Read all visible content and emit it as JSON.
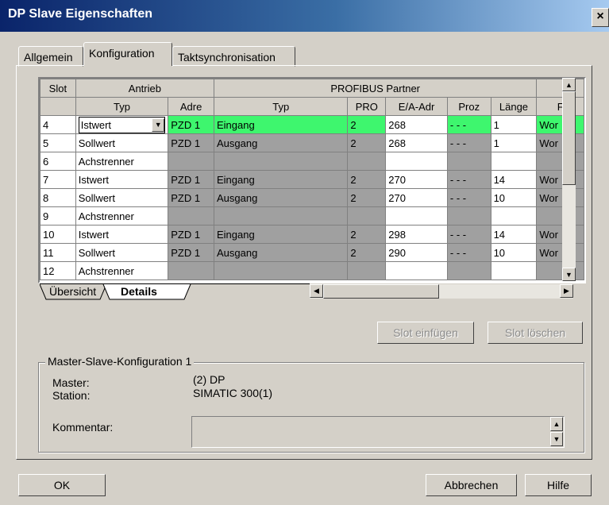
{
  "window": {
    "title": "DP Slave Eigenschaften",
    "close": "×"
  },
  "tabs": [
    "Allgemein",
    "Konfiguration",
    "Taktsynchronisation"
  ],
  "grid": {
    "group_headers": {
      "slot": "Slot",
      "antrieb": "Antrieb",
      "profibus": "PROFIBUS Partner"
    },
    "columns": [
      "Typ",
      "Adre",
      "Typ",
      "PRO",
      "E/A-Adr",
      "Proz",
      "Länge",
      "F"
    ],
    "rows": [
      [
        "4",
        "Istwert",
        "PZD 1",
        "Eingang",
        "2",
        "268",
        "- - -",
        "1",
        "Wor"
      ],
      [
        "5",
        "Sollwert",
        "PZD 1",
        "Ausgang",
        "2",
        "268",
        "- - -",
        "1",
        "Wor"
      ],
      [
        "6",
        "Achstrenner",
        "",
        "",
        "",
        "",
        "",
        "",
        ""
      ],
      [
        "7",
        "Istwert",
        "PZD 1",
        "Eingang",
        "2",
        "270",
        "- - -",
        "14",
        "Wor"
      ],
      [
        "8",
        "Sollwert",
        "PZD 1",
        "Ausgang",
        "2",
        "270",
        "- - -",
        "10",
        "Wor"
      ],
      [
        "9",
        "Achstrenner",
        "",
        "",
        "",
        "",
        "",
        "",
        ""
      ],
      [
        "10",
        "Istwert",
        "PZD 1",
        "Eingang",
        "2",
        "298",
        "- - -",
        "14",
        "Wor"
      ],
      [
        "11",
        "Sollwert",
        "PZD 1",
        "Ausgang",
        "2",
        "290",
        "- - -",
        "10",
        "Wor"
      ],
      [
        "12",
        "Achstrenner",
        "",
        "",
        "",
        "",
        "",
        "",
        ""
      ]
    ],
    "selected_row": 0
  },
  "sheet_tabs": [
    "Übersicht",
    "Details"
  ],
  "buttons": {
    "slot_insert": "Slot einfügen",
    "slot_delete": "Slot löschen",
    "ok": "OK",
    "cancel": "Abbrechen",
    "help": "Hilfe"
  },
  "master_slave": {
    "legend": "Master-Slave-Konfiguration 1",
    "master_label": "Master:",
    "master_value": "(2) DP",
    "station_label": "Station:",
    "station_value": "SIMATIC 300(1)",
    "comment_label": "Kommentar:"
  },
  "colors": {
    "selected_row": "#3ef66e",
    "title_bar": "#0a246a"
  }
}
